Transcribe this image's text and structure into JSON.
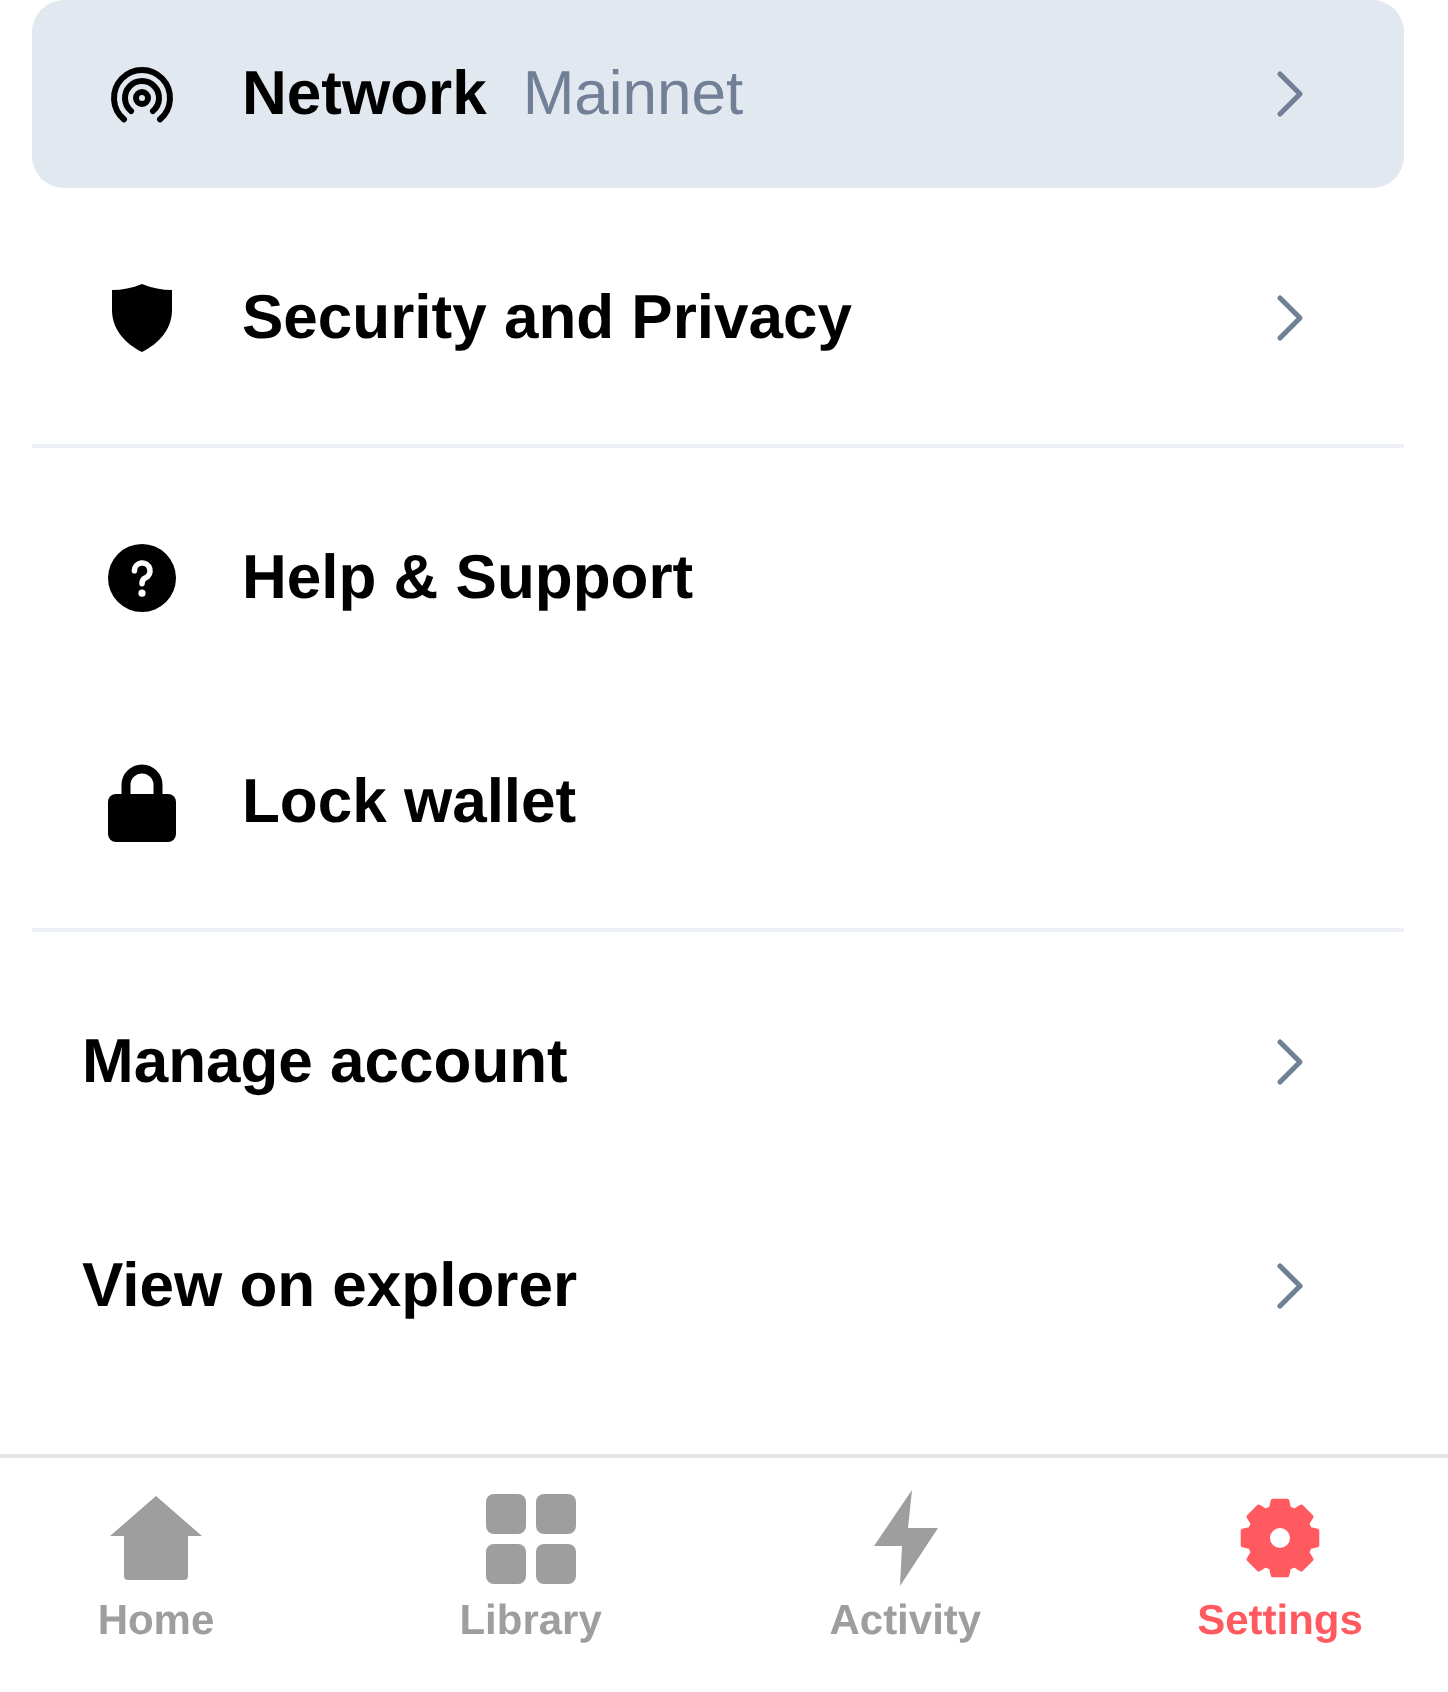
{
  "sections": [
    {
      "items": [
        {
          "kind": "link",
          "label": "Network",
          "value": "Mainnet",
          "selected": true
        },
        {
          "kind": "link",
          "label": "Security and Privacy",
          "selected": false
        }
      ]
    },
    {
      "items": [
        {
          "kind": "action",
          "label": "Help & Support",
          "selected": false
        },
        {
          "kind": "action",
          "label": "Lock wallet",
          "selected": false
        }
      ]
    },
    {
      "items": [
        {
          "kind": "link",
          "label": "Manage account",
          "selected": false
        },
        {
          "kind": "link",
          "label": "View on explorer",
          "selected": false
        }
      ]
    }
  ],
  "tab_bar": [
    {
      "label": "Home",
      "selected": false
    },
    {
      "label": "Library",
      "selected": false
    },
    {
      "label": "Activity",
      "selected": false
    },
    {
      "label": "Settings",
      "selected": true
    }
  ]
}
